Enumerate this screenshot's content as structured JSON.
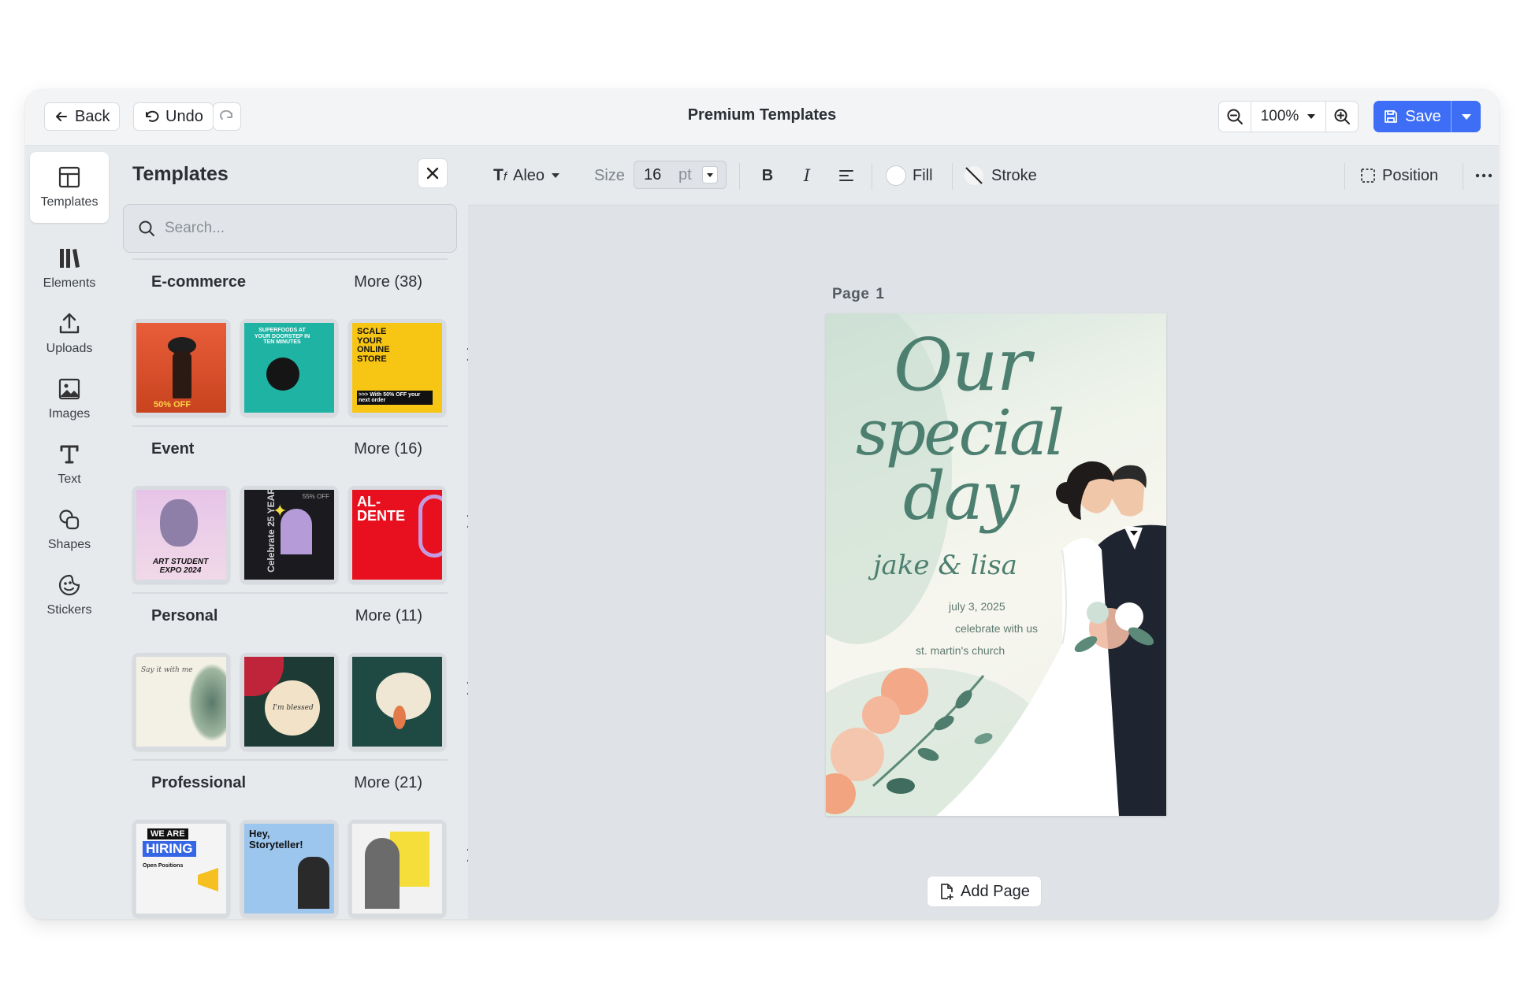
{
  "topbar": {
    "back_label": "Back",
    "undo_label": "Undo",
    "title": "Premium Templates",
    "zoom_value": "100%",
    "save_label": "Save"
  },
  "rail": {
    "items": [
      {
        "label": "Templates",
        "icon": "layout-icon"
      },
      {
        "label": "Elements",
        "icon": "library-icon"
      },
      {
        "label": "Uploads",
        "icon": "upload-icon"
      },
      {
        "label": "Images",
        "icon": "image-icon"
      },
      {
        "label": "Text",
        "icon": "text-icon"
      },
      {
        "label": "Shapes",
        "icon": "shapes-icon"
      },
      {
        "label": "Stickers",
        "icon": "sticker-icon"
      }
    ]
  },
  "panel": {
    "title": "Templates",
    "search_placeholder": "Search...",
    "sections": [
      {
        "name": "E-commerce",
        "more": "More (38)"
      },
      {
        "name": "Event",
        "more": "More (16)"
      },
      {
        "name": "Personal",
        "more": "More (11)"
      },
      {
        "name": "Professional",
        "more": "More (21)"
      }
    ],
    "thumb_text": {
      "scale_store": "SCALE YOUR ONLINE STORE",
      "scale_offer": ">>> With 50% OFF your next order",
      "superfoods": "SUPERFOODS AT YOUR DOORSTEP IN TEN MINUTES",
      "fashion_off": "50% OFF",
      "art_student": "ART STUDENT EXPO 2024",
      "celebrate": "Celebrate 25 YEARS",
      "celebrate_off": "55% OFF",
      "al_dente": "AL-DENTE",
      "say_it": "Say it with me",
      "in_bloom": "I'm blessed",
      "we_are": "WE ARE",
      "hiring": "HIRING",
      "open_positions": "Open Positions",
      "storyteller": "Hey, Storyteller!"
    }
  },
  "toolbar": {
    "font_name": "Aleo",
    "size_label": "Size",
    "size_value": "16",
    "size_unit": "pt",
    "fill_label": "Fill",
    "stroke_label": "Stroke",
    "position_label": "Position"
  },
  "canvas": {
    "page_label": "Page",
    "page_number": "1",
    "add_page_label": "Add Page"
  },
  "card": {
    "line1": "Our",
    "line2": "special",
    "line3": "day",
    "names": "jake & lisa",
    "date": "july 3, 2025",
    "celebrate": "celebrate with us",
    "venue": "st. martin's church"
  },
  "colors": {
    "accent": "#3d6ef5",
    "script_green": "#4c7f70",
    "panel_bg": "#e7eaed"
  }
}
